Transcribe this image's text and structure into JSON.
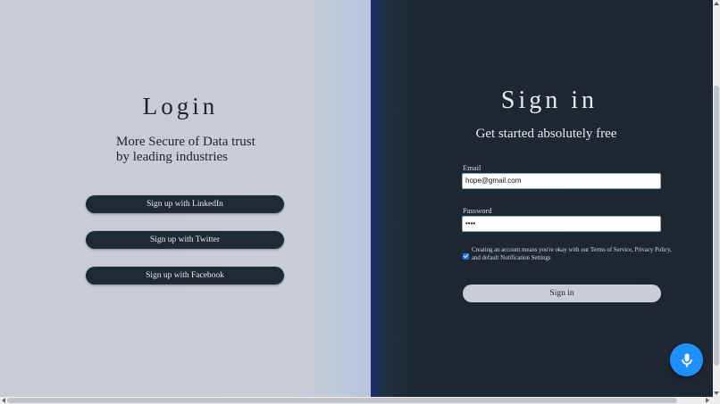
{
  "left_panel": {
    "title": "Login",
    "tagline": "More Secure of Data trust\nby leading industries",
    "buttons": [
      {
        "label": "Sign up with LinkedIn"
      },
      {
        "label": "Sign up with Twitter"
      },
      {
        "label": "Sign up with Facebook"
      }
    ]
  },
  "right_panel": {
    "title": "Sign in",
    "subtitle": "Get started absolutely free",
    "email_label": "Email",
    "email_value": "hope@gmail.com",
    "password_label": "Password",
    "password_value": "••••",
    "terms_checked": true,
    "terms_text": "Creating an account means you're okay with our Terms of Service, Privacy Policy, and default Notification Settings",
    "signin_label": "Sign in"
  },
  "icons": {
    "mic": "microphone-icon"
  },
  "colors": {
    "left_bg": "#c9ccd2",
    "right_bg": "#1d2731",
    "social_button": "#1f2a35",
    "signin_button": "#c8cdd6",
    "mic_button": "#1e90ff"
  }
}
